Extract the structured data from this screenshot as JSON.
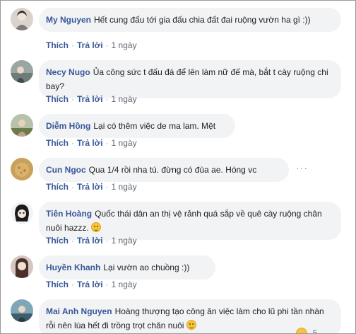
{
  "actions": {
    "like": "Thích",
    "reply": "Trả lời",
    "separator": "·"
  },
  "more_icon": "···",
  "comments": [
    {
      "author": "My Nguyen",
      "text": "Hết cung đấu tới gia đấu chia đất đai ruộng vườn ha gì :))",
      "time": "1 ngày"
    },
    {
      "author": "Necy Nugo",
      "text": "Ủa công sức t đấu đá để lên làm nữ đế mà, bắt t cày ruộng chi bay?",
      "time": "1 ngày"
    },
    {
      "author": "Diễm Hồng",
      "text": "Lại có thêm việc de ma lam. Mệt",
      "time": "1 ngày"
    },
    {
      "author": "Cun Ngoc",
      "text": "Qua 1/4 rồi nha tú. đừng có đùa ae. Hóng vc",
      "time": "1 ngày"
    },
    {
      "author": "Tiên Hoàng",
      "text": "Quốc thái dân an thị vệ rảnh quá sắp về quê cày ruộng chân nuôi hazzz.",
      "emoji": "smirk-emoji-icon",
      "time": "1 ngày"
    },
    {
      "author": "Huyền Khanh",
      "text": "Lại vườn ao chuồng :))",
      "time": "1 ngày"
    },
    {
      "author": "Mai Anh Nguyen",
      "text": "Hoàng thượng tạo công ăn việc làm cho lũ phi tần nhàn rỗi nên lùa hết đi trồng trọt chăn nuôi",
      "emoji": "smile-emoji-icon",
      "reaction_count": "5"
    }
  ],
  "colors": {
    "name": "#385898",
    "bubble": "#f2f3f5",
    "meta": "#606770"
  }
}
